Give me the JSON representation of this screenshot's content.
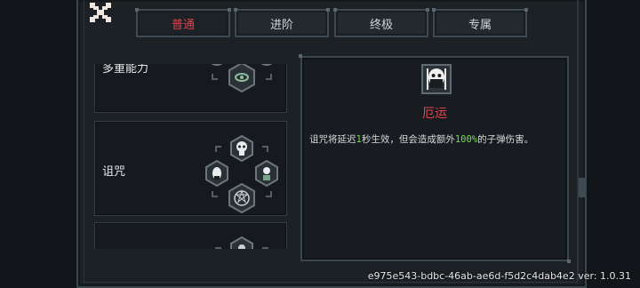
{
  "tabs": [
    {
      "label": "普通",
      "active": true
    },
    {
      "label": "进阶",
      "active": false
    },
    {
      "label": "终极",
      "active": false
    },
    {
      "label": "专属",
      "active": false
    }
  ],
  "skills": [
    {
      "name": "多重能力"
    },
    {
      "name": "诅咒"
    },
    {
      "name": ""
    }
  ],
  "detail": {
    "icon": "mask-icon",
    "title": "厄运",
    "desc_before": "诅咒将延迟",
    "desc_num1": "1",
    "desc_middle": "秒生效，但会造成额外",
    "desc_num2": "100%",
    "desc_after": "的子弹伤害。"
  },
  "version_text": "e975e543-bdbc-46ab-ae6d-f5d2c4dab4e2 ver: 1.0.31",
  "colors": {
    "accent_red": "#e0444f",
    "highlight_green": "#6ee04a"
  }
}
